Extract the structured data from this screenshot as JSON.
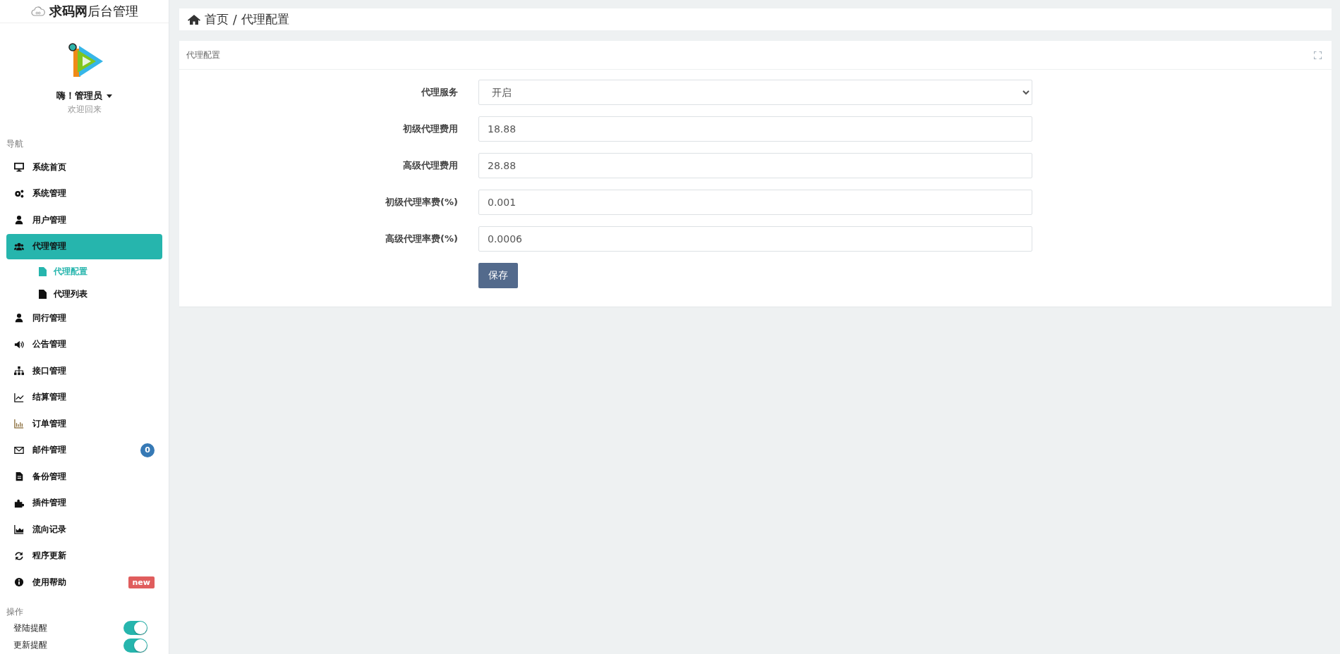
{
  "sidebar": {
    "brand": "**求码网**后台管理",
    "user": {
      "greeting": "嗨！管理员",
      "subtitle": "欢迎回来"
    },
    "nav_heading": "导航",
    "items": [
      {
        "label": "系统首页",
        "selected": false
      },
      {
        "label": "系统管理",
        "selected": false
      },
      {
        "label": "用户管理",
        "selected": false
      },
      {
        "label": "代理管理",
        "selected": true,
        "children": [
          {
            "label": "代理配置",
            "selected": true
          },
          {
            "label": "代理列表",
            "selected": false
          }
        ]
      },
      {
        "label": "同行管理",
        "selected": false
      },
      {
        "label": "公告管理",
        "selected": false
      },
      {
        "label": "接口管理",
        "selected": false
      },
      {
        "label": "结算管理",
        "selected": false
      },
      {
        "label": "订单管理",
        "selected": false
      },
      {
        "label": "邮件管理",
        "selected": false,
        "badge": {
          "kind": "count",
          "text": "0"
        }
      },
      {
        "label": "备份管理",
        "selected": false
      },
      {
        "label": "插件管理",
        "selected": false
      },
      {
        "label": "流向记录",
        "selected": false
      },
      {
        "label": "程序更新",
        "selected": false
      },
      {
        "label": "使用帮助",
        "selected": false,
        "badge": {
          "kind": "tag",
          "text": "new"
        }
      }
    ],
    "ops_heading": "操作",
    "toggles": [
      {
        "label": "登陆提醒",
        "on": true
      },
      {
        "label": "更新提醒",
        "on": true
      }
    ]
  },
  "breadcrumb": {
    "separator": "/",
    "items": [
      "首页",
      "代理配置"
    ]
  },
  "panel": {
    "title": "代理配置",
    "fields": [
      {
        "kind": "select",
        "label": "代理服务",
        "value": "开启"
      },
      {
        "kind": "input",
        "label": "初级代理费用",
        "value": "18.88"
      },
      {
        "kind": "input",
        "label": "高级代理费用",
        "value": "28.88"
      },
      {
        "kind": "input",
        "label": "初级代理率费(%)",
        "value": "0.001"
      },
      {
        "kind": "input",
        "label": "高级代理率费(%)",
        "value": "0.0006"
      }
    ],
    "submit": "保存"
  }
}
